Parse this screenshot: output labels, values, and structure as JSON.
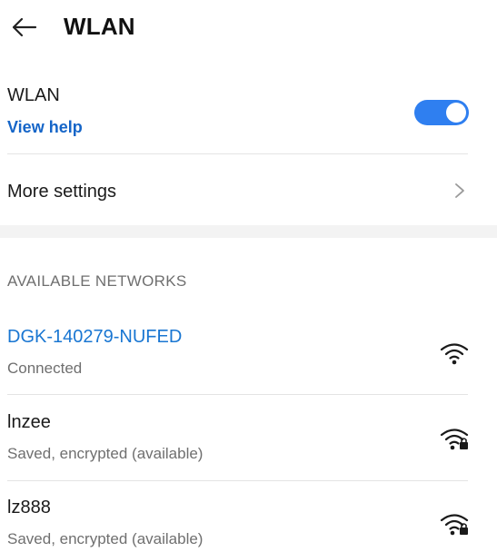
{
  "header": {
    "title": "WLAN"
  },
  "wlan": {
    "label": "WLAN",
    "help_link": "View help",
    "enabled": true
  },
  "more_settings": {
    "label": "More settings"
  },
  "networks": {
    "section_title": "AVAILABLE NETWORKS",
    "items": [
      {
        "name": "DGK-140279-NUFED",
        "status": "Connected",
        "icon": "wifi-icon"
      },
      {
        "name": "lnzee",
        "status": "Saved, encrypted (available)",
        "icon": "wifi-lock-icon"
      },
      {
        "name": "lz888",
        "status": "Saved, encrypted (available)",
        "icon": "wifi-lock-icon"
      }
    ]
  },
  "colors": {
    "accent": "#1565c8",
    "toggle_on": "#2f7ff0"
  }
}
